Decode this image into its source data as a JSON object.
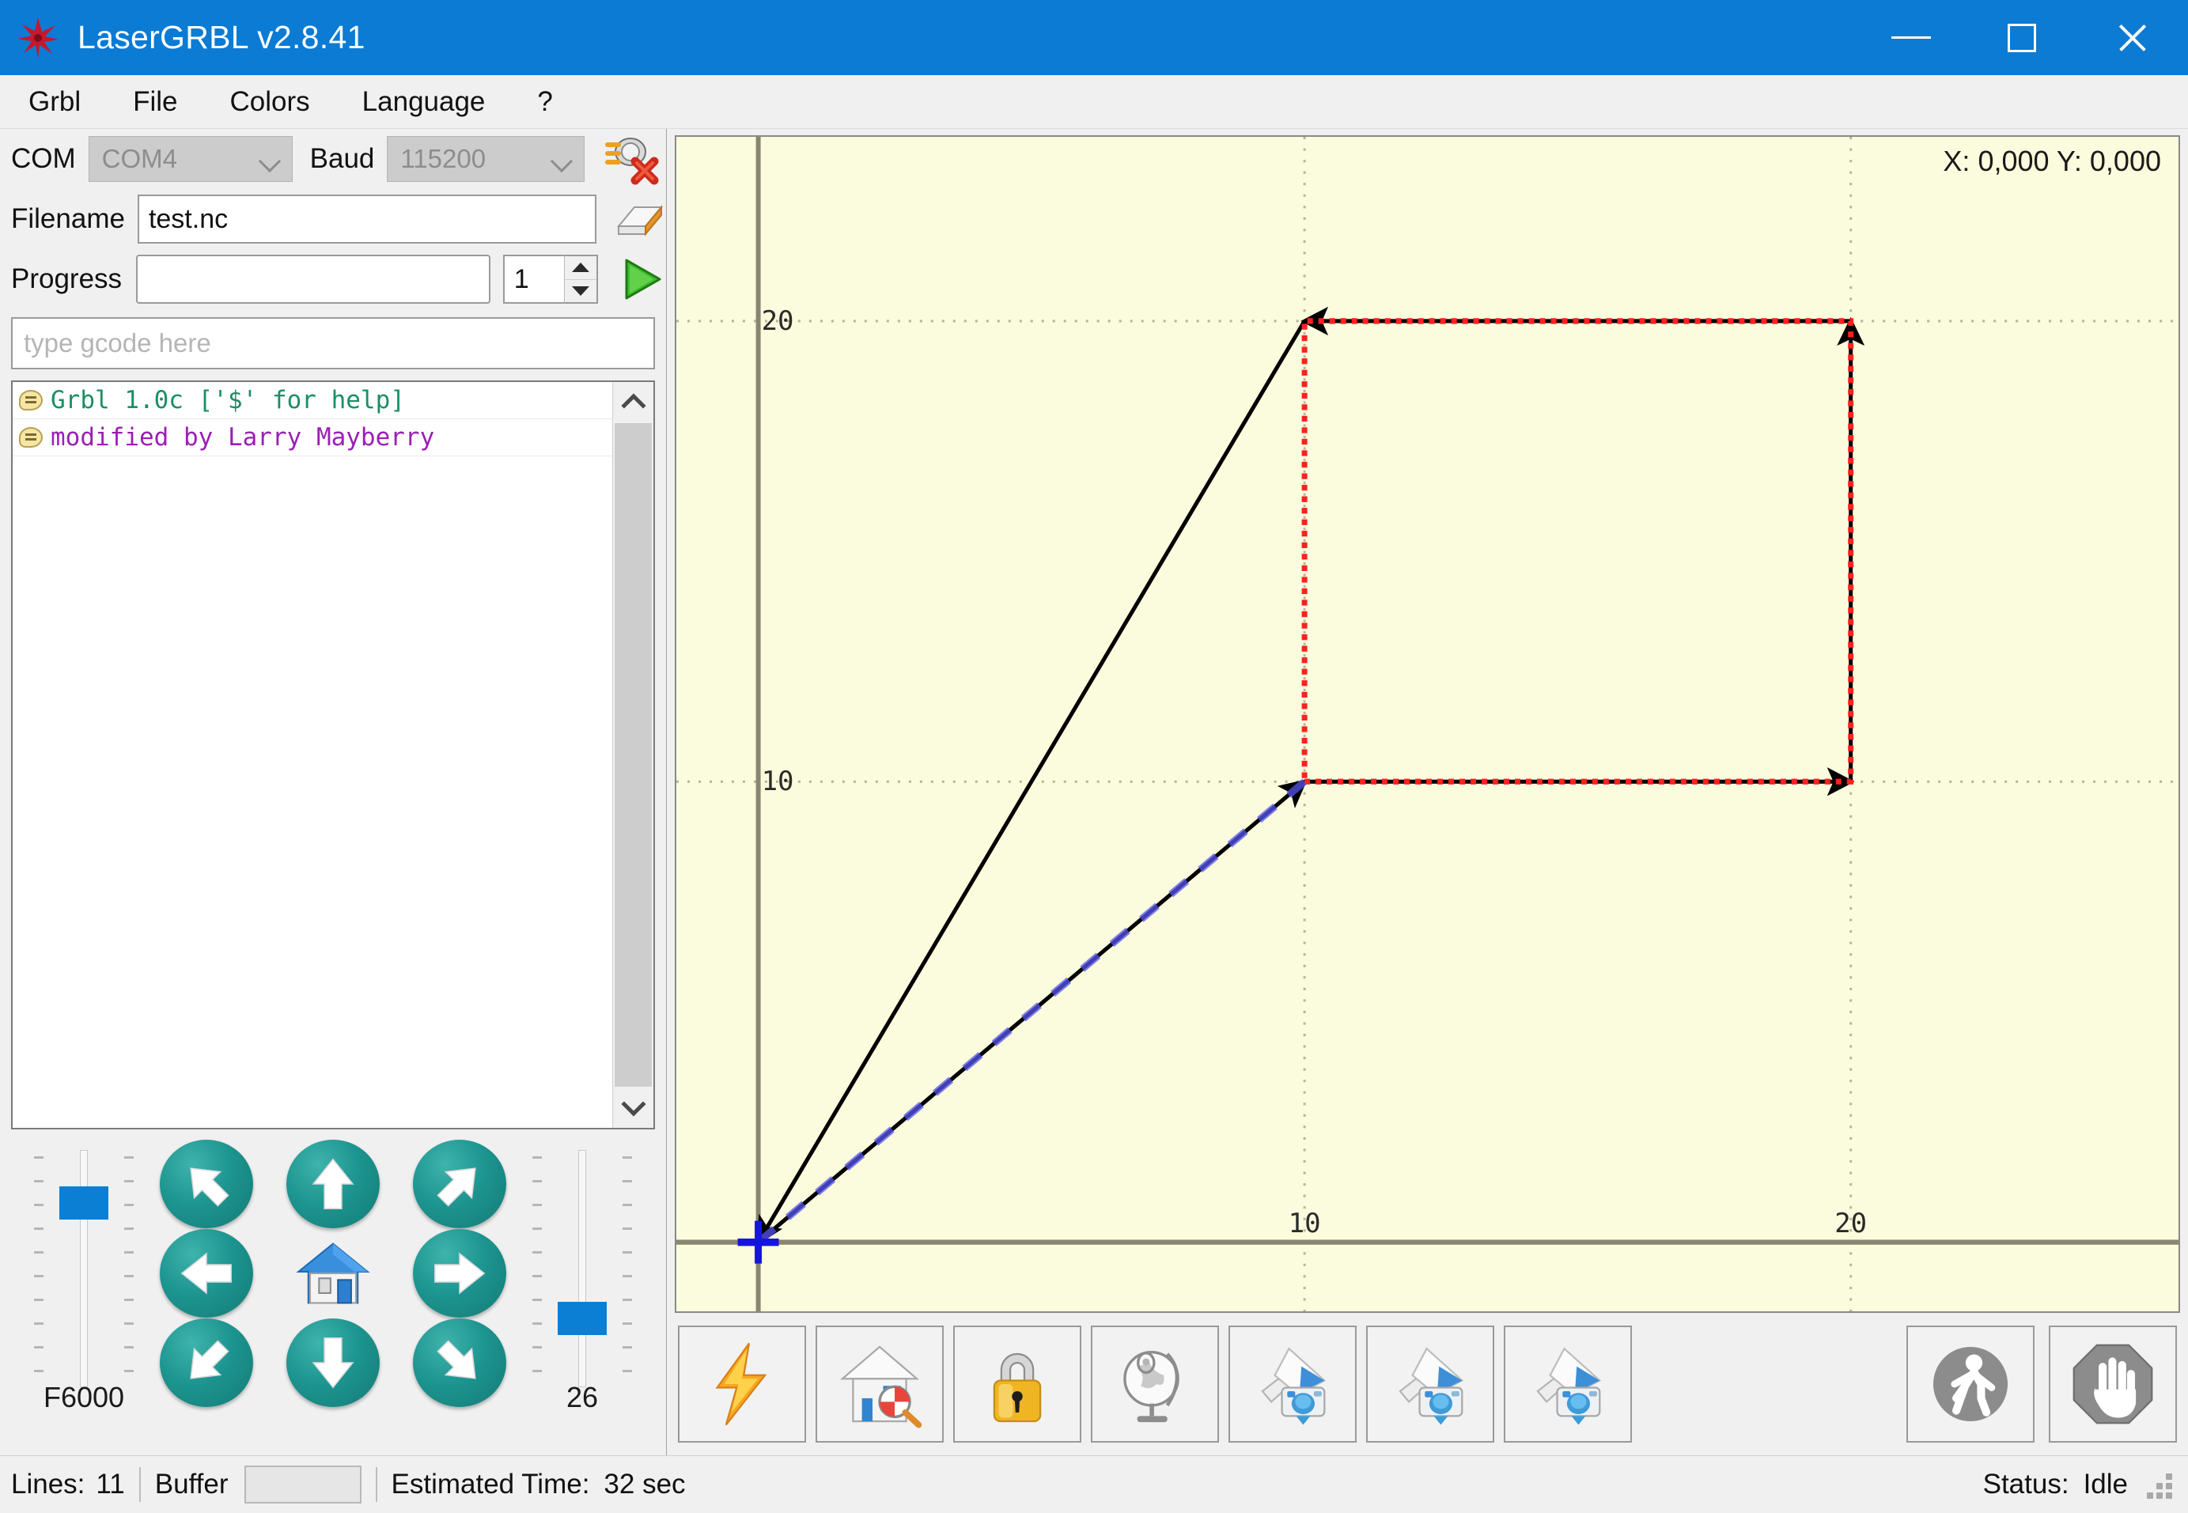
{
  "window": {
    "title": "LaserGRBL v2.8.41",
    "icon": "lasergrbl-logo-icon",
    "controls": {
      "minimize": "minimize-button",
      "maximize": "maximize-button",
      "close": "close-button"
    },
    "accent": "#0b7bd4"
  },
  "menubar": {
    "items": [
      "Grbl",
      "File",
      "Colors",
      "Language",
      "?"
    ]
  },
  "connection": {
    "com_label": "COM",
    "com_value": "COM4",
    "baud_label": "Baud",
    "baud_value": "115200",
    "connect_icon": "disconnect-plug-icon"
  },
  "file": {
    "filename_label": "Filename",
    "filename_value": "test.nc",
    "open_icon": "open-file-icon"
  },
  "progress": {
    "label": "Progress",
    "value": "",
    "percent": 0,
    "repeat_count": "1",
    "run_icon": "run-play-icon"
  },
  "gcode_input": {
    "placeholder": "type gcode here",
    "value": ""
  },
  "console": {
    "lines": [
      {
        "text": "Grbl 1.0c ['$' for help]",
        "color": "#1a8f63"
      },
      {
        "text": "modified by Larry Mayberry",
        "color": "#9b1fb5"
      }
    ],
    "scroll_up_icon": "chevron-up-icon",
    "scroll_down_icon": "chevron-down-icon"
  },
  "jog": {
    "feed_label": "F6000",
    "feed_thumb_percent": 22,
    "step_label": "26",
    "step_thumb_percent": 72,
    "buttons": [
      {
        "name": "jog-up-left",
        "icon": "arrow-up-left-icon"
      },
      {
        "name": "jog-up",
        "icon": "arrow-up-icon"
      },
      {
        "name": "jog-up-right",
        "icon": "arrow-up-right-icon"
      },
      {
        "name": "jog-left",
        "icon": "arrow-left-icon"
      },
      {
        "name": "jog-home",
        "icon": "house-icon"
      },
      {
        "name": "jog-right",
        "icon": "arrow-right-icon"
      },
      {
        "name": "jog-down-left",
        "icon": "arrow-down-left-icon"
      },
      {
        "name": "jog-down",
        "icon": "arrow-down-icon"
      },
      {
        "name": "jog-down-right",
        "icon": "arrow-down-right-icon"
      }
    ]
  },
  "preview": {
    "coordinates": "X: 0,000 Y: 0,000",
    "background": "#fbfbdd",
    "origin_marker": "origin-crosshair-icon"
  },
  "toolbar": {
    "left_buttons": [
      {
        "name": "unlock-alarm-button",
        "icon": "lightning-bolt-icon"
      },
      {
        "name": "home-button",
        "icon": "house-magnifier-icon"
      },
      {
        "name": "safety-lock-button",
        "icon": "padlock-icon"
      },
      {
        "name": "set-origin-button",
        "icon": "globe-stand-icon"
      },
      {
        "name": "return-to-zero-button",
        "icon": "photo-camera-one-icon"
      },
      {
        "name": "frame-preview-button",
        "icon": "photo-camera-two-icon"
      },
      {
        "name": "frame-repeat-button",
        "icon": "photo-camera-three-icon"
      }
    ],
    "right_buttons": [
      {
        "name": "feed-hold-resume-button",
        "icon": "walking-person-icon"
      },
      {
        "name": "stop-button",
        "icon": "stop-hand-icon"
      }
    ]
  },
  "statusbar": {
    "lines_label": "Lines:",
    "lines_value": "11",
    "buffer_label": "Buffer",
    "buffer_percent": 0,
    "estimated_label": "Estimated Time:",
    "estimated_value": "32 sec",
    "status_label": "Status:",
    "status_value": "Idle",
    "resize_grip": "resize-grip-icon"
  },
  "chart_data": {
    "type": "line",
    "title": "",
    "xlabel": "",
    "ylabel": "",
    "xlim": [
      -1.5,
      26.0
    ],
    "ylim": [
      -1.5,
      24.0
    ],
    "x_ticks": [
      10,
      20
    ],
    "y_ticks": [
      10,
      20
    ],
    "grid": true,
    "grid_color": "#b9b59a",
    "axis_color": "#8a8570",
    "series": [
      {
        "name": "rapid-travel-path",
        "color": "#000000",
        "style": "solid-with-arrows",
        "points": [
          [
            0,
            0
          ],
          [
            10,
            10
          ],
          [
            20,
            10
          ],
          [
            20,
            20
          ],
          [
            10,
            20
          ],
          [
            0,
            0
          ]
        ]
      },
      {
        "name": "laser-on-path",
        "color": "#ff2020",
        "style": "dotted",
        "points": [
          [
            10,
            10
          ],
          [
            20,
            10
          ],
          [
            20,
            20
          ],
          [
            10,
            20
          ],
          [
            10,
            10
          ]
        ]
      },
      {
        "name": "previous-segment-highlight",
        "color": "#5555ee",
        "style": "dashed",
        "points": [
          [
            0,
            0
          ],
          [
            10,
            10
          ]
        ]
      }
    ],
    "markers": [
      {
        "name": "origin",
        "x": 0,
        "y": 0,
        "color": "#1515e0",
        "shape": "cross"
      }
    ]
  }
}
